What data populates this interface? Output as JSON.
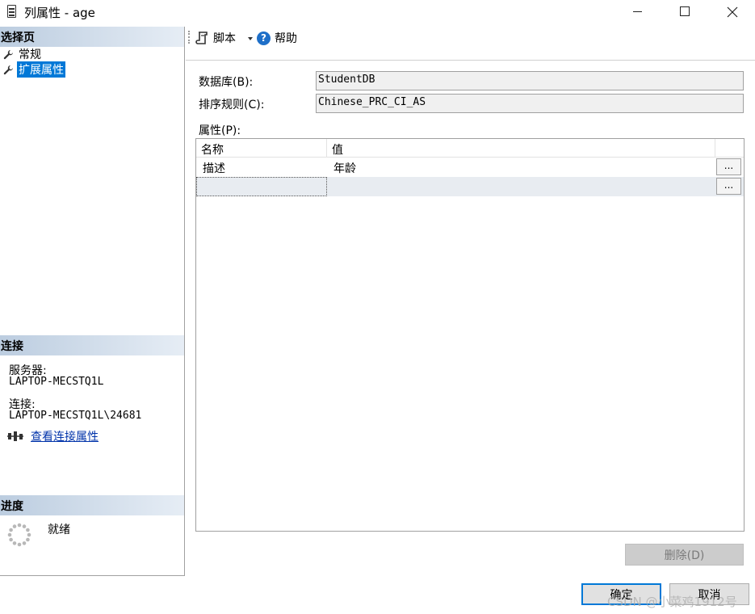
{
  "window": {
    "title": "列属性 - age",
    "controls": {
      "minimize": "minimize",
      "maximize": "maximize",
      "close": "close"
    }
  },
  "left_pane": {
    "select_page": {
      "header": "选择页",
      "items": [
        {
          "label": "常规",
          "icon": "wrench-icon",
          "selected": false
        },
        {
          "label": "扩展属性",
          "icon": "wrench-icon",
          "selected": true
        }
      ]
    },
    "connection": {
      "header": "连接",
      "server_label": "服务器:",
      "server_value": "LAPTOP-MECSTQ1L",
      "connection_label": "连接:",
      "connection_value": "LAPTOP-MECSTQ1L\\24681",
      "link_text": "查看连接属性"
    },
    "progress": {
      "header": "进度",
      "status": "就绪"
    }
  },
  "toolbar": {
    "script_label": "脚本",
    "help_label": "帮助"
  },
  "form": {
    "database_label": "数据库(B):",
    "database_value": "StudentDB",
    "collation_label": "排序规则(C):",
    "collation_value": "Chinese_PRC_CI_AS",
    "properties_label": "属性(P):"
  },
  "grid": {
    "columns": [
      "名称",
      "值"
    ],
    "rows": [
      {
        "name": "描述",
        "value": "年龄"
      },
      {
        "name": "",
        "value": ""
      }
    ],
    "ellipsis": "..."
  },
  "buttons": {
    "delete": "删除(D)",
    "ok": "确定",
    "cancel": "取消"
  },
  "watermark": "CSDN @小菜鸡1912号",
  "colors": {
    "selection": "#0078d7",
    "section_header": "#bccde0",
    "link": "#0033aa",
    "help_icon": "#1e6fc8"
  }
}
